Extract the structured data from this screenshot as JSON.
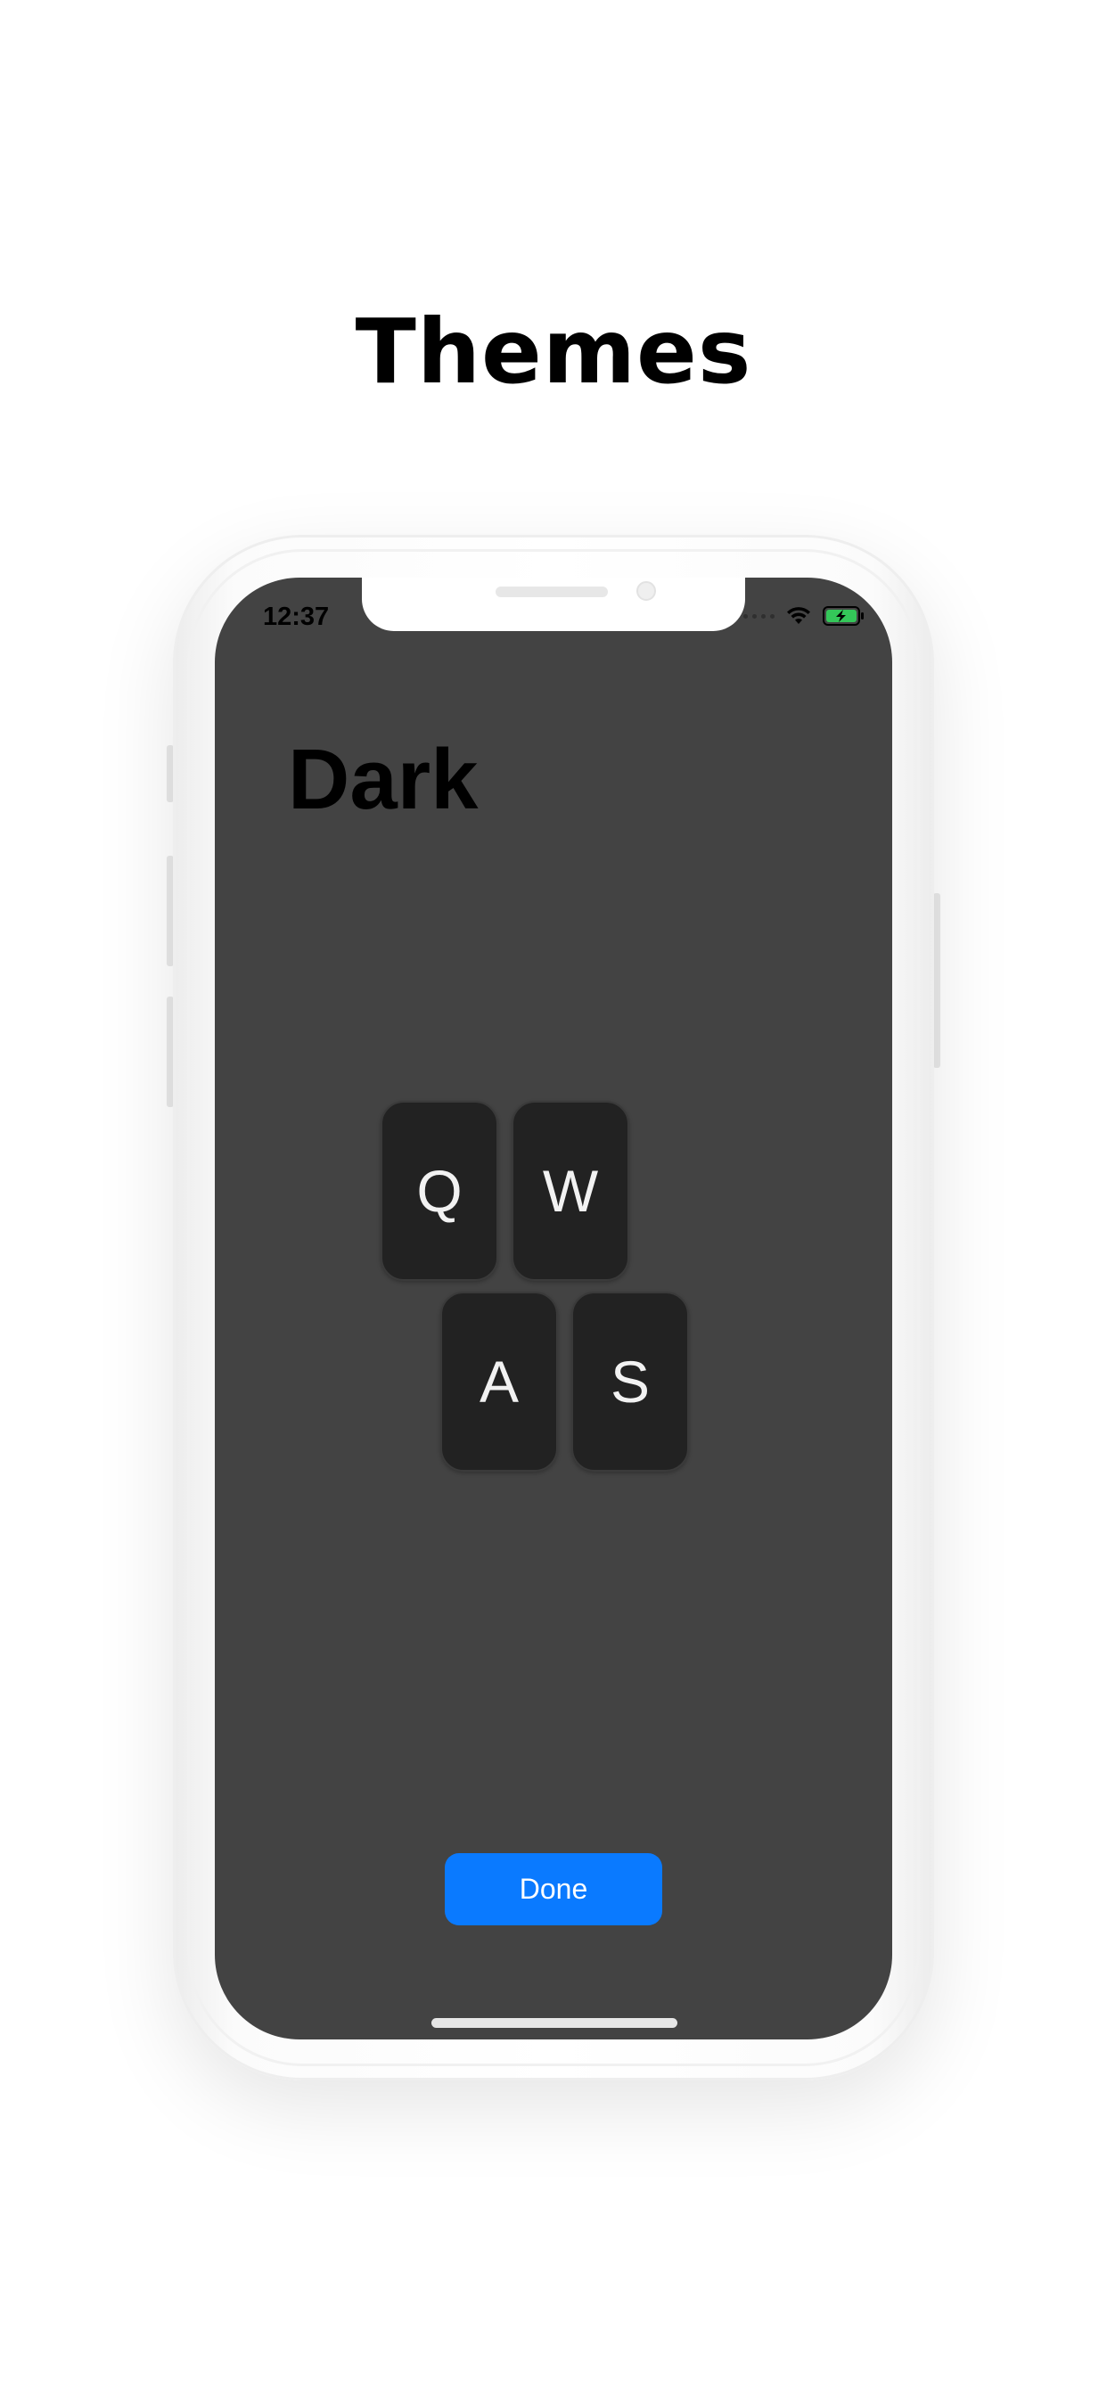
{
  "page": {
    "heading": "Themes"
  },
  "status_bar": {
    "time": "12:37",
    "signal_icon": "cellular-signal-icon",
    "wifi_icon": "wifi-icon",
    "battery_icon": "battery-charging-icon",
    "battery_color": "#34c759"
  },
  "theme": {
    "name": "Dark",
    "background_color": "#434343",
    "key_color": "#222222",
    "key_text_color": "#f2f2f2"
  },
  "keys": [
    {
      "label": "Q"
    },
    {
      "label": "W"
    },
    {
      "label": "A"
    },
    {
      "label": "S"
    }
  ],
  "done_button": {
    "label": "Done",
    "color": "#0a7aff"
  }
}
